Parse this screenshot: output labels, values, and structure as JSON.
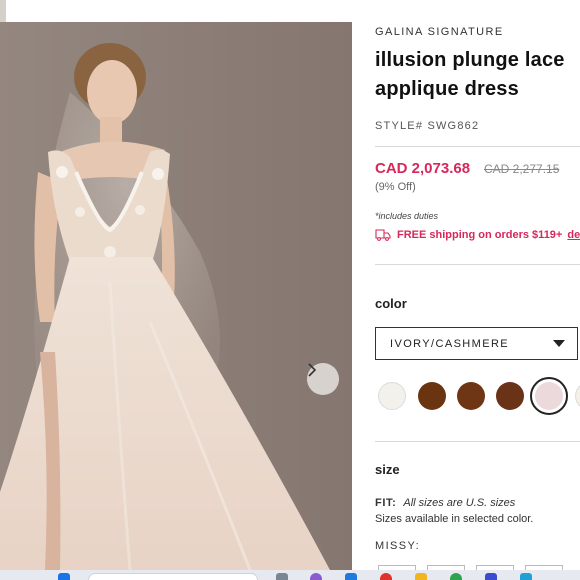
{
  "product": {
    "brand": "GALINA SIGNATURE",
    "title": "illusion plunge lace applique dress",
    "style_label": "STYLE#",
    "style_number": "SWG862",
    "price": "CAD 2,073.68",
    "original_price": "CAD 2,277.15",
    "discount": "(9% Off)",
    "duties_note": "*includes duties",
    "shipping_text": "FREE shipping on orders $119+",
    "shipping_link": "details"
  },
  "color": {
    "label": "color",
    "selected": "IVORY/CASHMERE",
    "swatches": [
      {
        "name": "ivory",
        "hex": "#f3f1ec"
      },
      {
        "name": "brown-1",
        "hex": "#6b3410"
      },
      {
        "name": "brown-2",
        "hex": "#6e3614"
      },
      {
        "name": "brown-3",
        "hex": "#6a3216"
      },
      {
        "name": "ivory-cashmere",
        "hex": "#ecd9dc"
      }
    ]
  },
  "size": {
    "label": "size",
    "fit_label": "FIT:",
    "fit_value": "All sizes are U.S. sizes",
    "availability_note": "Sizes available in selected color.",
    "group_label": "MISSY:"
  },
  "colors": {
    "accent": "#d6285a",
    "text": "#222222",
    "border": "#333333"
  },
  "icons": {
    "next": "chevron-right-icon",
    "shipping": "truck-icon",
    "dropdown": "caret-down-icon"
  }
}
